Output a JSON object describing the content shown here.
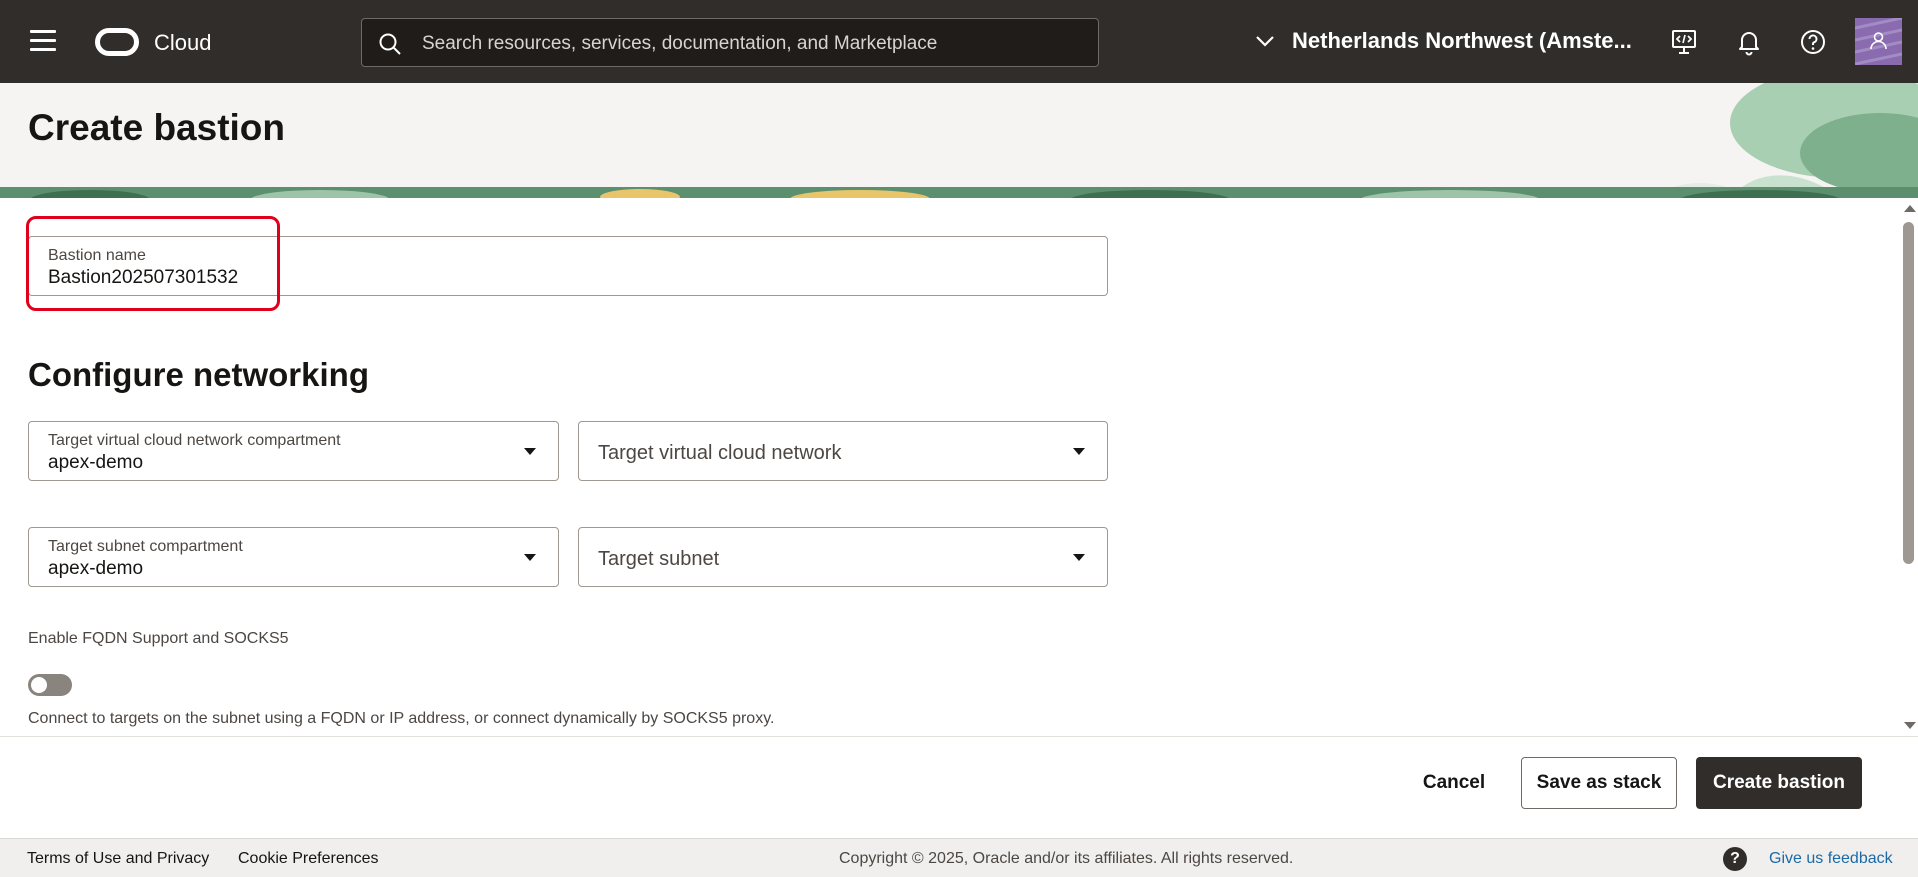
{
  "header": {
    "brand": "Cloud",
    "search_placeholder": "Search resources, services, documentation, and Marketplace",
    "region": "Netherlands Northwest (Amste..."
  },
  "page": {
    "title": "Create bastion"
  },
  "form": {
    "bastion_name": {
      "label": "Bastion name",
      "value": "Bastion202507301532"
    },
    "networking_title": "Configure networking",
    "vcn_compartment": {
      "label": "Target virtual cloud network compartment",
      "value": "apex-demo"
    },
    "vcn": {
      "placeholder": "Target virtual cloud network"
    },
    "subnet_compartment": {
      "label": "Target subnet compartment",
      "value": "apex-demo"
    },
    "subnet": {
      "placeholder": "Target subnet"
    },
    "fqdn": {
      "label": "Enable FQDN Support and SOCKS5",
      "enabled": false,
      "help": "Connect to targets on the subnet using a FQDN or IP address, or connect dynamically by SOCKS5 proxy."
    }
  },
  "actions": {
    "cancel": "Cancel",
    "save_stack": "Save as stack",
    "create": "Create bastion"
  },
  "footer": {
    "terms": "Terms of Use and Privacy",
    "cookies": "Cookie Preferences",
    "copyright": "Copyright © 2025, Oracle and/or its affiliates. All rights reserved.",
    "help_glyph": "?",
    "feedback": "Give us feedback"
  },
  "icons": {
    "menu": "hamburger-menu-icon",
    "logo": "oracle-cloud-logo-icon",
    "search": "search-icon",
    "region_chevron": "chevron-down-icon",
    "cloud_shell": "code-editor-icon",
    "notifications": "bell-icon",
    "help": "help-circle-icon",
    "profile": "user-icon"
  },
  "colors": {
    "topbar": "#312d2a",
    "primary_button": "#312d2a",
    "highlight": "#e0001b",
    "link": "#1a6aa8"
  }
}
